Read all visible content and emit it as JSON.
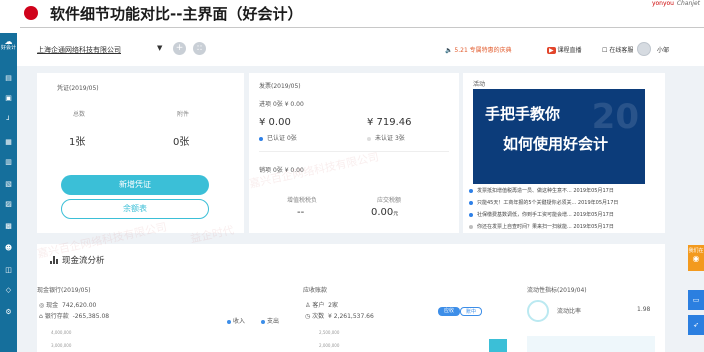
{
  "slide": {
    "title": "软件细节功能对比--主界面（好会计）",
    "brand_left": "yonyou",
    "brand_right": "Chanjet"
  },
  "sidebar": {
    "logo_label": "好会计",
    "items": [
      "home-icon",
      "voucher-icon",
      "ledger-icon",
      "report-icon",
      "invoice-icon",
      "tax-icon",
      "asset-icon",
      "salary-icon",
      "cash-icon",
      "stock-icon",
      "customer-icon",
      "settings-icon"
    ]
  },
  "topbar": {
    "company": "上海企通网络科技有限公司",
    "caret": "▼",
    "add_btn": "+",
    "grid_btn": "::",
    "notice": "5.21 专属特惠的庆典",
    "course": "课程直播",
    "service": "在线客服",
    "user": "小邹"
  },
  "voucher": {
    "title": "凭证(2019/05)",
    "count_label": "总数",
    "count_value": "1张",
    "attach_label": "附件",
    "attach_value": "0张",
    "new_btn": "新增凭证",
    "balance_btn": "余额表"
  },
  "invoice": {
    "title": "发票(2019/05)",
    "in_label": "进项",
    "in_count": "0张",
    "in_amount": "¥ 0.00",
    "left_value": "¥ 0.00",
    "left_sub": "已认证",
    "left_sub_count": "0张",
    "right_value": "¥ 719.46",
    "right_sub": "未认证",
    "right_sub_count": "3张",
    "out_label": "销项",
    "out_count": "0张",
    "out_amount": "¥ 0.00",
    "tax_label": "增值税税负",
    "tax_value": "--",
    "surcharge_label": "应交税额",
    "surcharge_value": "0.00",
    "surcharge_unit": "元"
  },
  "activity": {
    "title": "活动",
    "promo_line1": "手把手教你",
    "promo_line2": "如何使用好会计",
    "promo_bg_num": "20",
    "news": [
      {
        "text": "发票抵扣增值税再造一员、做这种生意不...",
        "date": "2019年05月17日",
        "color": "#2f80e7"
      },
      {
        "text": "只能45天！工商年报的5个关键疑你必须关...",
        "date": "2019年05月17日",
        "color": "#2f80e7"
      },
      {
        "text": "社保缴费基数调低，你到手工资可能会增...",
        "date": "2019年05月17日",
        "color": "#2f80e7"
      },
      {
        "text": "你还在发票上自查时间？果来扫一扫就能...",
        "date": "2019年05月17日",
        "color": "#bfbfbf"
      }
    ]
  },
  "cashflow": {
    "title": "现金流分析",
    "bank_title": "现金银行(2019/05)",
    "cash_label": "现金",
    "cash_value": "742,620.00",
    "bank_label": "银行存款",
    "bank_value": "-265,385.08",
    "legend_in": "收入",
    "legend_out": "支出",
    "axis_top": "4,000,000",
    "axis_bottom": "3,000,000",
    "ar_title": "应收账款",
    "ar_customer_label": "客户",
    "ar_customer_value": "2家",
    "ar_count_label": "次数",
    "ar_amount": "¥ 2,261,537.66",
    "seg_a": "应收",
    "seg_b": "账中",
    "ar_axis_top": "2,500,000",
    "ar_axis_bottom": "2,000,000",
    "liquidity_title": "流动性指标(2019/04)",
    "ratio_label": "流动比率",
    "ratio_value": "1.98"
  },
  "right_float": {
    "label_top": "我们在",
    "label_bottom": ""
  },
  "watermarks": [
    "嘉兴百企网络科技有限公司",
    "益企时代"
  ],
  "colors": {
    "accent": "#3bbfd7",
    "sidebar": "#156f9c",
    "title_dot": "#d0021b",
    "promo": "#0c3c7a",
    "badge": "#f39a1e",
    "float_blue": "#2b7fe0"
  }
}
